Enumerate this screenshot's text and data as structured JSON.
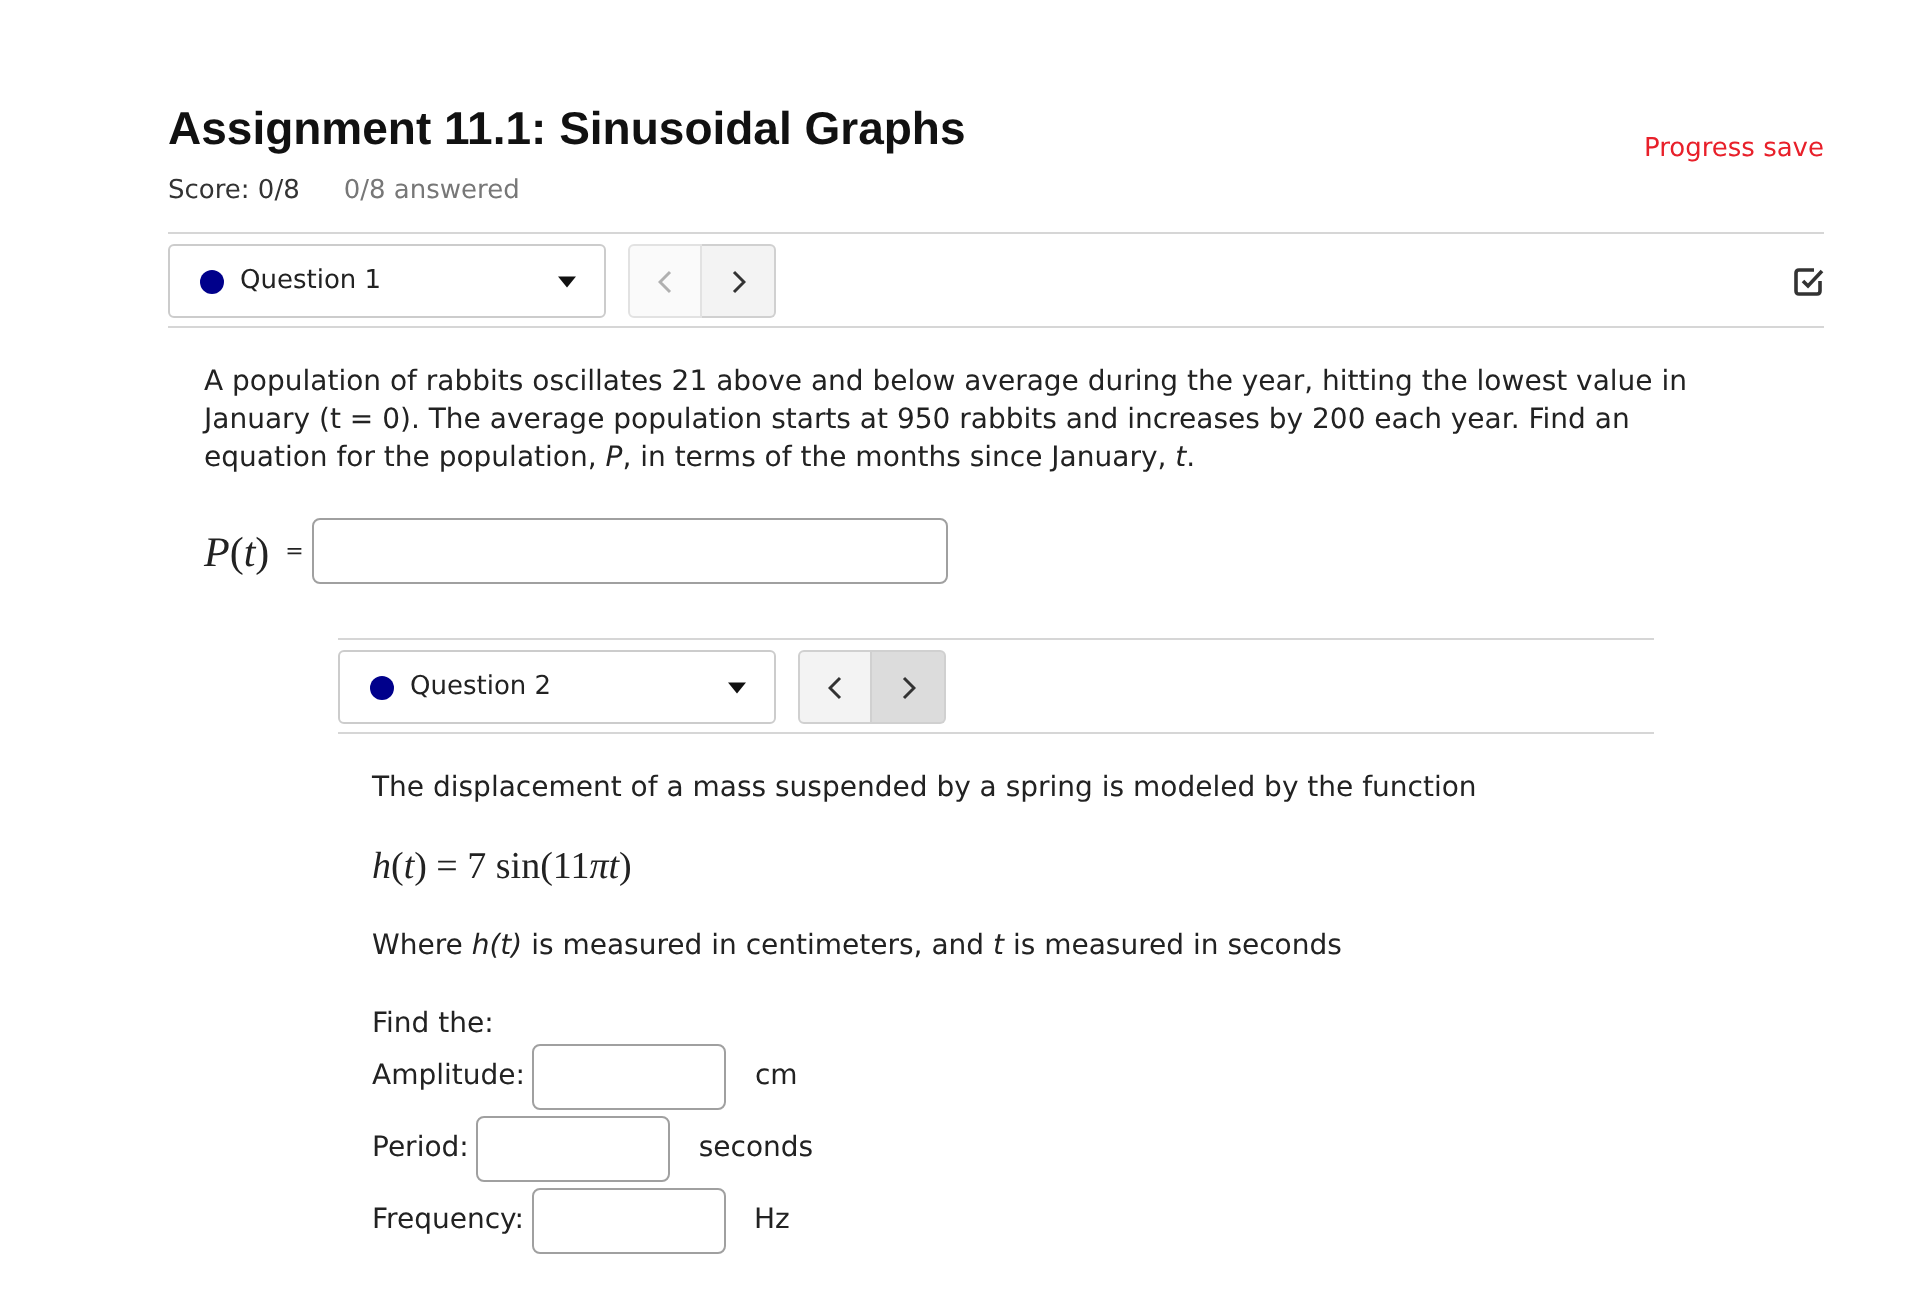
{
  "header": {
    "title": "Assignment 11.1: Sinusoidal Graphs",
    "score": "Score: 0/8",
    "answered": "0/8 answered",
    "progress": "Progress save"
  },
  "questions": [
    {
      "kind": "equation",
      "selector": {
        "label": "Question 1",
        "color": "#00008b"
      },
      "nav": [
        {
          "kind": "prev",
          "disabled": true,
          "highlighted": false
        },
        {
          "kind": "next",
          "disabled": false,
          "highlighted": false
        }
      ],
      "check_icon": true,
      "text": "A population of rabbits oscillates 21 above and below average during the year, hitting the lowest value in January (t = 0). The average population starts at 950 rabbits and increases by 200 each year. Find an equation for the population, *P*, in terms of the months since January, *t*.",
      "answer": {
        "label": "*P*(*t*)",
        "equals": "="
      }
    },
    {
      "kind": "parts",
      "selector": {
        "label": "Question 2",
        "color": "#00008b"
      },
      "nav": [
        {
          "kind": "prev",
          "disabled": false,
          "highlighted": false
        },
        {
          "kind": "next",
          "disabled": false,
          "highlighted": true
        }
      ],
      "text": "The displacement of a mass suspended by a spring is modeled by the function",
      "equation": "h(t) = 7 sin(11πt)",
      "note": "Where *h(t)* is measured in centimeters, and *t* is measured in seconds",
      "prompt": "Find the:",
      "parts": [
        {
          "label": "Amplitude:",
          "unit": "cm"
        },
        {
          "label": "Period:",
          "unit": "seconds"
        },
        {
          "label": "Frequency:",
          "unit": "Hz"
        }
      ]
    }
  ]
}
